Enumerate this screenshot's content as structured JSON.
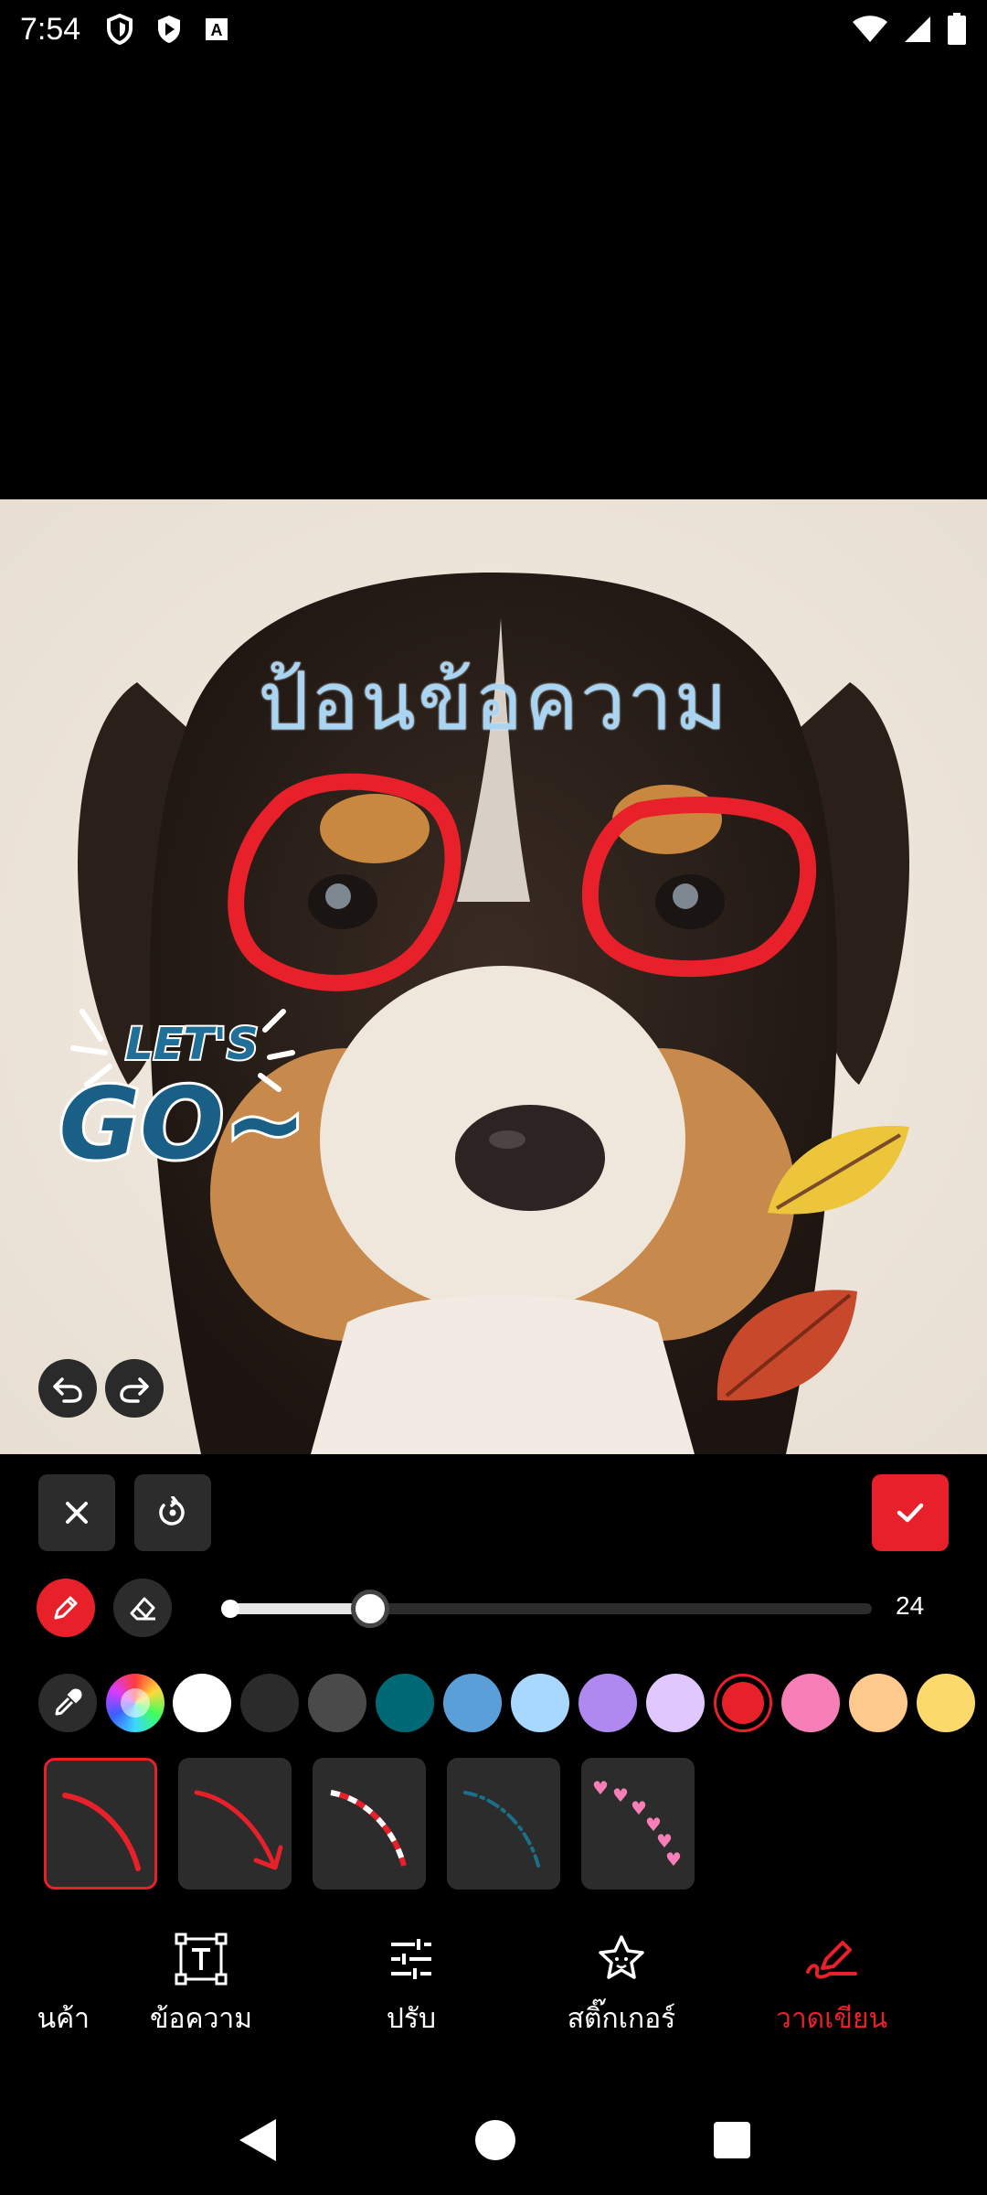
{
  "status_bar": {
    "time": "7:54",
    "icons": [
      "shield-icon",
      "play-store-icon",
      "font-icon",
      "wifi-icon",
      "signal-icon",
      "battery-icon"
    ]
  },
  "canvas": {
    "overlay_text": "ป้อนข้อความ",
    "overlay_text_color": "#a9d4f2",
    "sticker_text": [
      "LET'S",
      "GO~"
    ],
    "draw_color": "#e8202a",
    "undo_icon": "undo-icon",
    "redo_icon": "redo-icon"
  },
  "toolbar": {
    "close_icon": "close-icon",
    "reset_icon": "reset-icon",
    "confirm_icon": "check-icon"
  },
  "brush_controls": {
    "pen_mode": "pen-icon",
    "eraser_mode": "eraser-icon",
    "size_value": "24",
    "size_fraction": 0.22
  },
  "palette": {
    "tools": [
      "eyedropper-icon",
      "color-wheel-icon"
    ],
    "colors": [
      "#ffffff",
      "#2b2b2b",
      "#4a4a4a",
      "#006976",
      "#5b9fd8",
      "#a8d8ff",
      "#b089f0",
      "#e0c8ff",
      "#e8202a",
      "#f77fb8",
      "#fdc98c",
      "#fbd96a"
    ],
    "selected_color": "#e8202a"
  },
  "brush_styles": [
    "solid-curve",
    "arrow-curve",
    "dashed-red-white",
    "dash-dot-teal",
    "hearts"
  ],
  "bottom_nav": {
    "items": [
      {
        "label": "นค้า",
        "icon": "product-icon"
      },
      {
        "label": "ข้อความ",
        "icon": "text-icon"
      },
      {
        "label": "ปรับ",
        "icon": "adjust-icon"
      },
      {
        "label": "สติ๊กเกอร์",
        "icon": "sticker-icon"
      },
      {
        "label": "วาดเขียน",
        "icon": "draw-icon",
        "active": true
      }
    ]
  },
  "system_nav": [
    "back-icon",
    "home-icon",
    "recents-icon"
  ]
}
